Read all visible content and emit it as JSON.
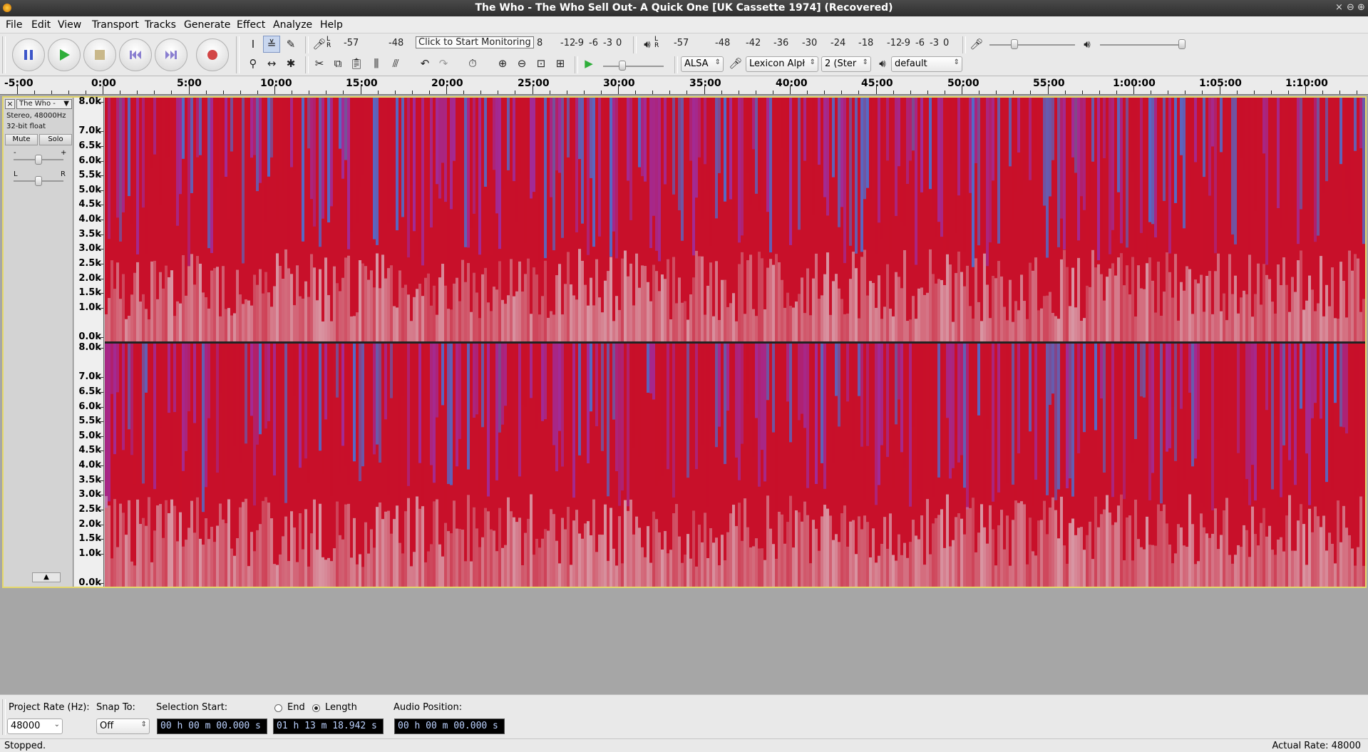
{
  "window": {
    "title": "The Who - The Who Sell Out- A Quick One [UK Cassette 1974] (Recovered)",
    "buttons": [
      "×",
      "⊖",
      "⊕"
    ]
  },
  "menu": [
    "File",
    "Edit",
    "View",
    "Transport",
    "Tracks",
    "Generate",
    "Effect",
    "Analyze",
    "Help"
  ],
  "transport": {
    "buttons": [
      "pause",
      "play",
      "stop",
      "skip-to-start",
      "skip-to-end",
      "record"
    ]
  },
  "meters": {
    "record_lr": "L R",
    "record_scale": [
      "-57",
      "-48",
      "-12",
      "-9",
      "-6",
      "-3",
      "0"
    ],
    "record_monitor_text": "Click to Start Monitoring",
    "record_partial": "8",
    "play_lr": "L R",
    "play_scale": [
      "-57",
      "-48",
      "-42",
      "-36",
      "-30",
      "-24",
      "-18",
      "-12",
      "-9",
      "-6",
      "-3",
      "0"
    ]
  },
  "device": {
    "host": "ALSA",
    "recording_device": "Lexicon Alpł",
    "channels": "2 (Ster",
    "playback_device": "default"
  },
  "ruler": {
    "labels": [
      "-5:00",
      "0:00",
      "5:00",
      "10:00",
      "15:00",
      "20:00",
      "25:00",
      "30:00",
      "35:00",
      "40:00",
      "45:00",
      "50:00",
      "55:00",
      "1:00:00",
      "1:05:00",
      "1:10:00"
    ]
  },
  "track": {
    "name": "The Who -",
    "info_line1": "Stereo, 48000Hz",
    "info_line2": "32-bit float",
    "mute_label": "Mute",
    "solo_label": "Solo",
    "gain_min": "-",
    "gain_max": "+",
    "pan_left": "L",
    "pan_right": "R",
    "freq_labels": [
      "8.0k",
      "7.0k",
      "6.5k",
      "6.0k",
      "5.5k",
      "5.0k",
      "4.5k",
      "4.0k",
      "3.5k",
      "3.0k",
      "2.5k",
      "2.0k",
      "1.5k",
      "1.0k",
      "0.0k"
    ]
  },
  "selection": {
    "project_rate_label": "Project Rate (Hz):",
    "project_rate": "48000",
    "snap_to_label": "Snap To:",
    "snap_to": "Off",
    "selection_start_label": "Selection Start:",
    "selection_start": "00 h 00 m 00.000 s",
    "end_label": "End",
    "length_label": "Length",
    "length_selected": true,
    "length_value": "01 h 13 m 18.942 s",
    "audio_position_label": "Audio Position:",
    "audio_position": "00 h 00 m 00.000 s"
  },
  "status": {
    "left": "Stopped.",
    "right": "Actual Rate: 48000"
  },
  "colors": {
    "track_border": "#e5d86a",
    "spectro_red": "#c8102a",
    "spectro_purple": "#a02c9c",
    "spectro_blue": "#4f6fcf",
    "spectro_white": "#e0d0d8"
  }
}
